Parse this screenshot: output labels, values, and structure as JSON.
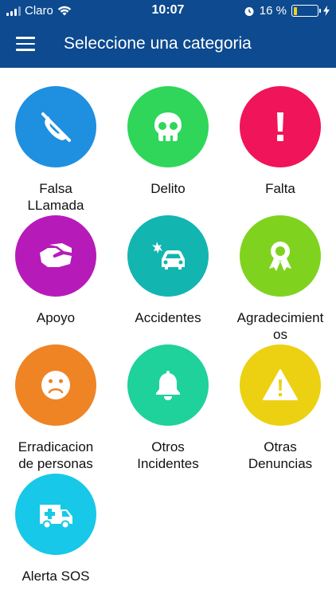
{
  "status": {
    "carrier": "Claro",
    "time": "10:07",
    "battery_pct": "16 %",
    "battery_level": 0.16,
    "battery_color": "#f4d21c"
  },
  "header": {
    "title": "Seleccione una categoria",
    "background": "#0d4a8f"
  },
  "categories": [
    {
      "label": "Falsa LLamada",
      "icon": "phone-cancel-icon",
      "color": "#1f8fe0"
    },
    {
      "label": "Delito",
      "icon": "skull-icon",
      "color": "#2fd65a"
    },
    {
      "label": "Falta",
      "icon": "exclamation-icon",
      "color": "#f0145a"
    },
    {
      "label": "Apoyo",
      "icon": "handshake-icon",
      "color": "#b61bb9"
    },
    {
      "label": "Accidentes",
      "icon": "car-crash-icon",
      "color": "#13b5b0"
    },
    {
      "label": "Agradecimientos",
      "icon": "award-ribbon-icon",
      "color": "#7fd31e"
    },
    {
      "label": "Erradicacion de personas",
      "icon": "sad-face-icon",
      "color": "#ef8425"
    },
    {
      "label": "Otros Incidentes",
      "icon": "bell-icon",
      "color": "#1fd19a"
    },
    {
      "label": "Otras Denuncias",
      "icon": "warning-icon",
      "color": "#ecd113"
    },
    {
      "label": "Alerta SOS",
      "icon": "ambulance-icon",
      "color": "#17c8e8"
    }
  ]
}
